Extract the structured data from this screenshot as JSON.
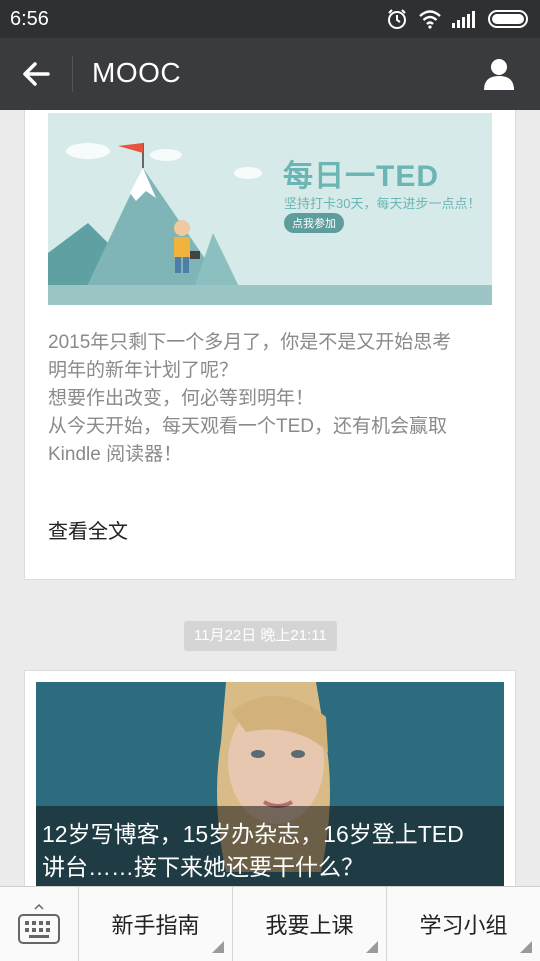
{
  "status": {
    "time": "6:56"
  },
  "header": {
    "title": "MOOC"
  },
  "card1": {
    "banner": {
      "title": "每日一TED",
      "subtitle": "坚持打卡30天，每天进步一点点！",
      "button": "点我参加"
    },
    "lines": [
      "2015年只剩下一个多月了，你是不是又开始思考",
      "明年的新年计划了呢？",
      "想要作出改变，何必等到明年！",
      "从今天开始，每天观看一个TED，还有机会赢取",
      "Kindle 阅读器！"
    ],
    "read_all": "查看全文"
  },
  "date_chip": "11月22日 晚上21:11",
  "card2": {
    "caption_lines": [
      "12岁写博客，15岁办杂志，16岁登上TED",
      "讲台……接下来她还要干什么？"
    ]
  },
  "bottom": {
    "tabs": [
      "新手指南",
      "我要上课",
      "学习小组"
    ]
  },
  "icons": [
    "alarm-icon",
    "wifi-icon",
    "signal-icon",
    "battery-icon",
    "back-arrow-icon",
    "user-icon",
    "keyboard-icon",
    "menu-corner-icon"
  ]
}
